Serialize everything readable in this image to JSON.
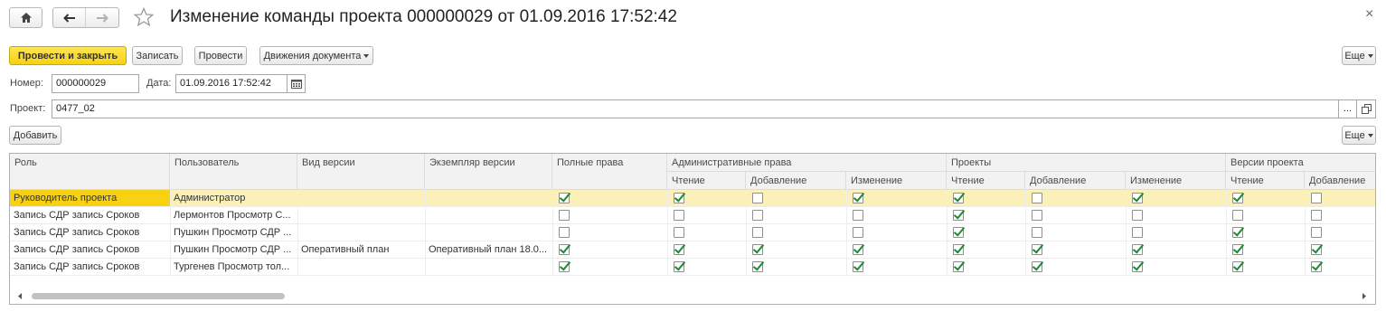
{
  "window": {
    "title": "Изменение команды проекта 000000029 от 01.09.2016 17:52:42",
    "close_glyph": "×"
  },
  "toolbar": {
    "post_close_label": "Провести и закрыть",
    "save_label": "Записать",
    "post_label": "Провести",
    "movements_label": "Движения документа",
    "more_label": "Еще"
  },
  "form": {
    "number_label": "Номер:",
    "number_value": "000000029",
    "date_label": "Дата:",
    "date_value": "01.09.2016 17:52:42",
    "project_label": "Проект:",
    "project_value": "0477_02",
    "select_glyph": "..."
  },
  "table_toolbar": {
    "add_label": "Добавить",
    "more_label": "Еще"
  },
  "table": {
    "headers": {
      "role": "Роль",
      "user": "Пользователь",
      "version_kind": "Вид версии",
      "version_instance": "Экземпляр версии",
      "full_rights": "Полные права",
      "admin_rights": "Административные права",
      "projects": "Проекты",
      "project_versions": "Версии проекта"
    },
    "subheaders": {
      "admin_read": "Чтение",
      "admin_add": "Добавление",
      "admin_edit": "Изменение",
      "proj_read": "Чтение",
      "proj_add": "Добавление",
      "proj_edit": "Изменение",
      "ver_read": "Чтение",
      "ver_add": "Добавление"
    },
    "rows": [
      {
        "role": "Руководитель проекта",
        "user": "Администратор",
        "version_kind": "",
        "version_instance": "",
        "checks": [
          true,
          true,
          false,
          true,
          true,
          false,
          true,
          true,
          false
        ]
      },
      {
        "role": "Запись СДР запись Сроков",
        "user": "Лермонтов Просмотр С...",
        "version_kind": "",
        "version_instance": "",
        "checks": [
          false,
          false,
          false,
          false,
          true,
          false,
          false,
          false,
          false
        ]
      },
      {
        "role": "Запись СДР запись Сроков",
        "user": "Пушкин Просмотр СДР ...",
        "version_kind": "",
        "version_instance": "",
        "checks": [
          false,
          false,
          false,
          false,
          true,
          false,
          false,
          true,
          false
        ]
      },
      {
        "role": "Запись СДР запись Сроков",
        "user": "Пушкин Просмотр СДР ...",
        "version_kind": "Оперативный план",
        "version_instance": "Оперативный план 18.0...",
        "checks": [
          true,
          true,
          true,
          true,
          true,
          true,
          true,
          true,
          true
        ]
      },
      {
        "role": "Запись СДР запись Сроков",
        "user": "Тургенев Просмотр тол...",
        "version_kind": "",
        "version_instance": "",
        "checks": [
          true,
          true,
          true,
          true,
          true,
          true,
          true,
          true,
          true
        ]
      }
    ]
  }
}
